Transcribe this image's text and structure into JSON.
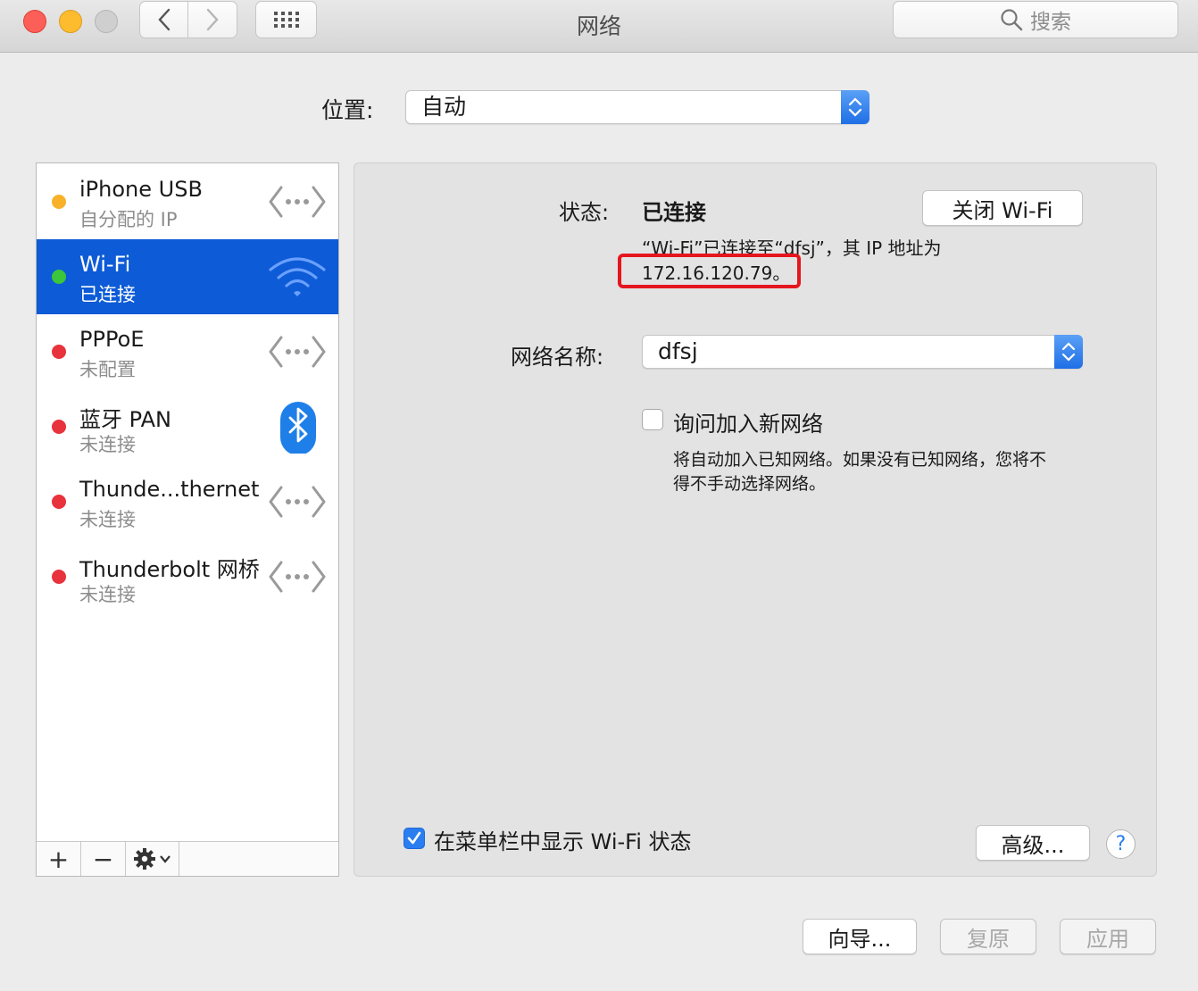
{
  "window": {
    "title": "网络",
    "search_placeholder": "搜索"
  },
  "location": {
    "label": "位置:",
    "value": "自动"
  },
  "services": [
    {
      "name": "iPhone USB",
      "status": "自分配的 IP",
      "dot_color": "#f7b12a",
      "icon": "ethernet-arrows-icon"
    },
    {
      "name": "Wi-Fi",
      "status": "已连接",
      "dot_color": "#3cc63c",
      "icon": "wifi-icon",
      "selected": true
    },
    {
      "name": "PPPoE",
      "status": "未配置",
      "dot_color": "#e8323c",
      "icon": "ethernet-arrows-icon"
    },
    {
      "name": "蓝牙 PAN",
      "status": "未连接",
      "dot_color": "#e8323c",
      "icon": "bluetooth-icon"
    },
    {
      "name": "Thunde...thernet",
      "status": "未连接",
      "dot_color": "#e8323c",
      "icon": "ethernet-arrows-icon"
    },
    {
      "name": "Thunderbolt 网桥",
      "status": "未连接",
      "dot_color": "#e8323c",
      "icon": "ethernet-arrows-icon"
    }
  ],
  "sidebar_controls": {
    "add": "+",
    "remove": "−"
  },
  "detail": {
    "status_label": "状态:",
    "status_value": "已连接",
    "toggle_button": "关闭 Wi-Fi",
    "status_desc_line1": "“Wi-Fi”已连接至“dfsj”，其 IP 地址为",
    "ip_line": "172.16.120.79。",
    "network_name_label": "网络名称:",
    "network_name_value": "dfsj",
    "ask_join_label": "询问加入新网络",
    "ask_join_checked": false,
    "ask_join_desc_line1": "将自动加入已知网络。如果没有已知网络，您将不",
    "ask_join_desc_line2": "得不手动选择网络。",
    "show_menubar_label": "在菜单栏中显示 Wi-Fi 状态",
    "show_menubar_checked": true,
    "advanced_button": "高级...",
    "help": "?"
  },
  "footer": {
    "assist_button": "向导...",
    "revert_button": "复原",
    "apply_button": "应用"
  },
  "colors": {
    "accent": "#0d5bd6",
    "highlight_box": "#e5161d"
  }
}
